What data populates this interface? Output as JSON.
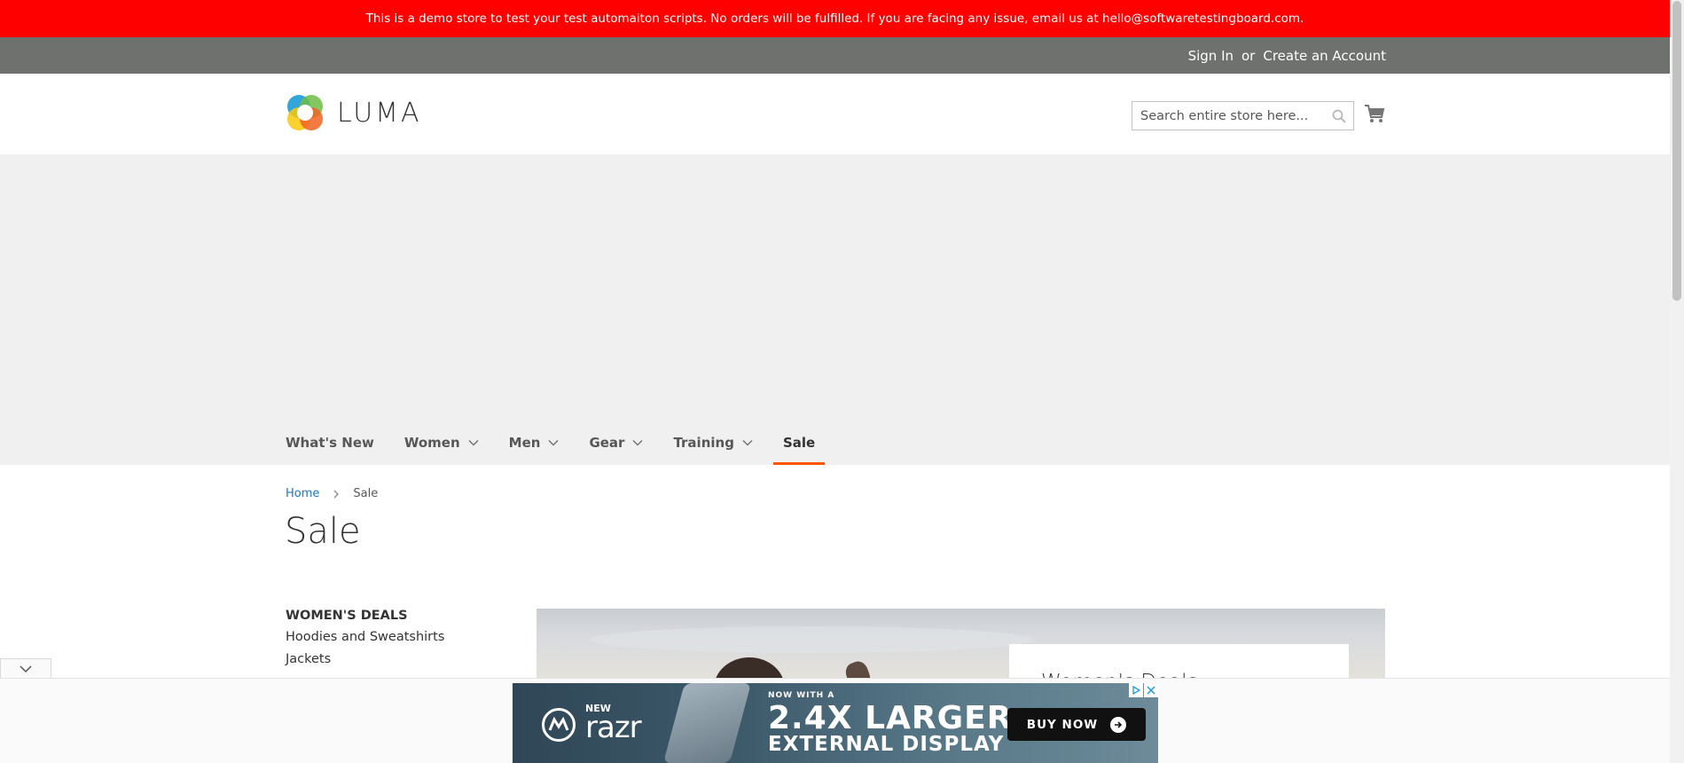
{
  "demo_notice": "This is a demo store to test your test automaiton scripts. No orders will be fulfilled. If you are facing any issue, email us at hello@softwaretestingboard.com.",
  "header": {
    "sign_in": "Sign In",
    "or": "or",
    "create_account": "Create an Account"
  },
  "logo": {
    "text": "LUMA"
  },
  "search": {
    "placeholder": "Search entire store here..."
  },
  "nav": {
    "items": [
      {
        "label": "What's New",
        "has_dropdown": false
      },
      {
        "label": "Women",
        "has_dropdown": true
      },
      {
        "label": "Men",
        "has_dropdown": true
      },
      {
        "label": "Gear",
        "has_dropdown": true
      },
      {
        "label": "Training",
        "has_dropdown": true
      },
      {
        "label": "Sale",
        "has_dropdown": false,
        "active": true
      }
    ],
    "active_color": "#ff5501"
  },
  "breadcrumb": {
    "home": "Home",
    "current": "Sale"
  },
  "page_title": "Sale",
  "sidebar": {
    "heading": "WOMEN'S DEALS",
    "links": [
      "Hoodies and Sweatshirts",
      "Jackets"
    ]
  },
  "hero": {
    "card_title": "Women's Deals"
  },
  "ad": {
    "new": "NEW",
    "brand": "razr",
    "now_with": "NOW WITH A",
    "headline": "2.4X LARGER",
    "subline": "EXTERNAL DISPLAY",
    "cta": "BUY NOW"
  },
  "colors": {
    "notice_bg": "#ff0000",
    "panel_bg": "#6e716e",
    "link": "#1979c3"
  }
}
